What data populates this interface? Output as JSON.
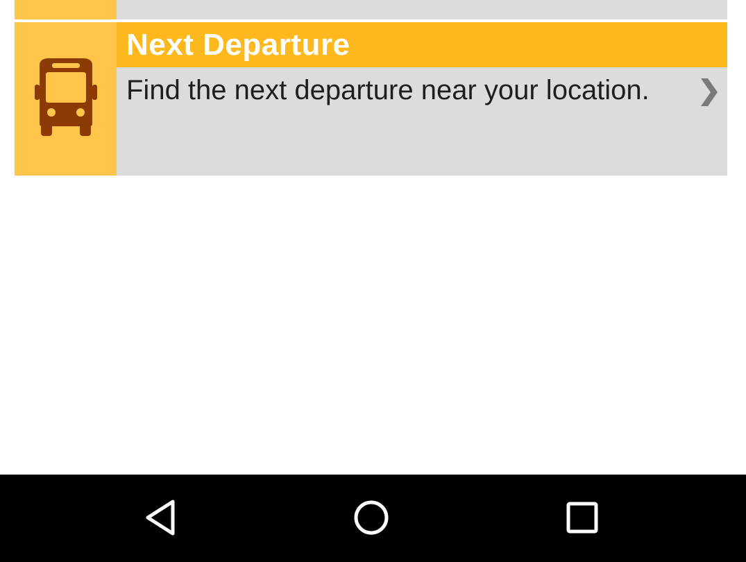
{
  "list": {
    "previous_item": {},
    "items": [
      {
        "title": "Next Departure",
        "description": "Find the next departure near your location.",
        "icon": "bus-icon",
        "trailing_icon": "chevron-right-icon"
      }
    ]
  },
  "colors": {
    "icon_background": "#fec54a",
    "title_bar": "#fdb81e",
    "card_body": "#dcdcdc",
    "bus_icon": "#8c3b05",
    "chevron": "#7a7a7a",
    "title_text": "#ffffff",
    "navbar": "#000000"
  },
  "navigation_bar": {
    "back": "back-icon",
    "home": "home-icon",
    "recents": "recents-icon"
  }
}
